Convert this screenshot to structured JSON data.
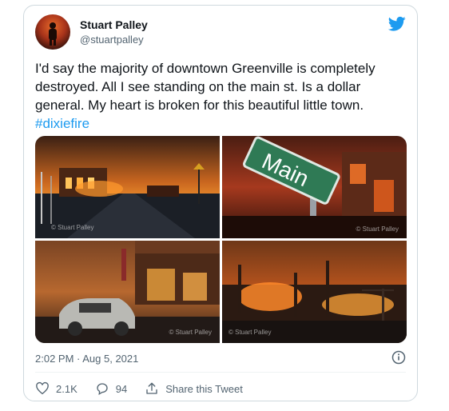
{
  "author": {
    "name": "Stuart Palley",
    "handle": "@stuartpalley"
  },
  "tweet": {
    "text": "I'd say the majority of downtown Greenville is completely destroyed. All I see standing on the main st. Is a dollar general. My heart is broken for this beautiful little town.",
    "hashtag": "#dixiefire",
    "timestamp": "2:02 PM · Aug 5, 2021"
  },
  "media": {
    "watermark": "© Stuart Palley",
    "sign_text": "Main"
  },
  "actions": {
    "likes": "2.1K",
    "replies": "94",
    "share_label": "Share this Tweet"
  },
  "colors": {
    "brand": "#1d9bf0",
    "like": "#536471",
    "text": "#0f1419",
    "muted": "#536471"
  }
}
